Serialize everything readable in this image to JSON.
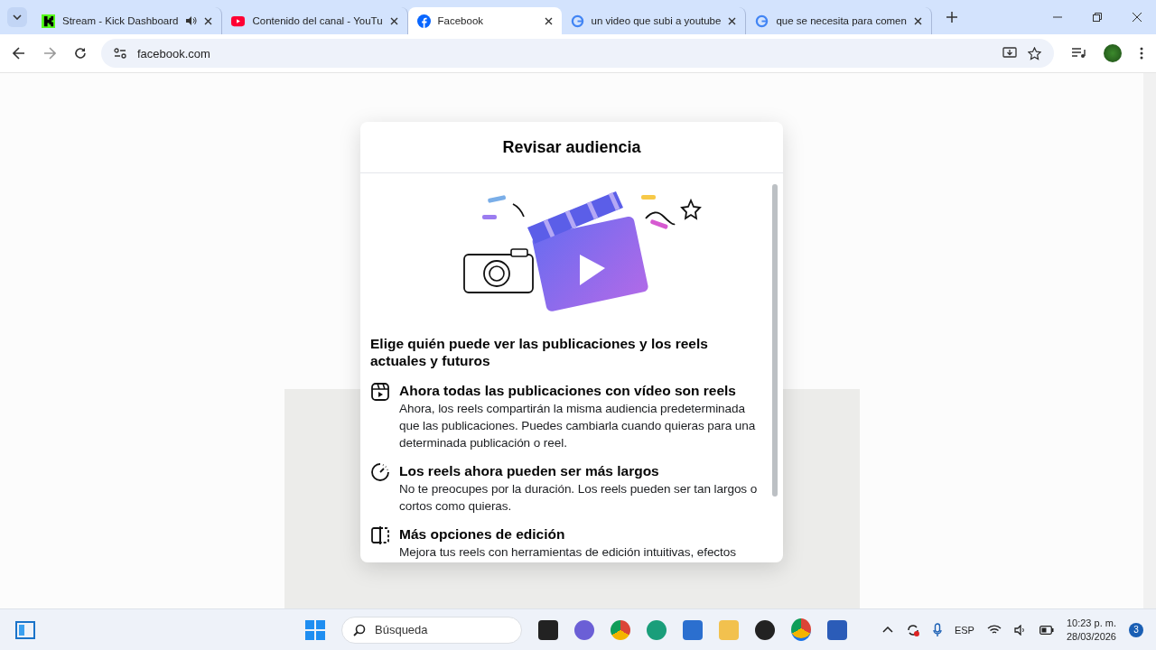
{
  "browser": {
    "tabs": [
      {
        "title": "Stream - Kick Dashboard",
        "audio": true,
        "selected": false
      },
      {
        "title": "Contenido del canal - YouTu",
        "audio": false,
        "selected": false
      },
      {
        "title": "Facebook",
        "audio": false,
        "selected": true
      },
      {
        "title": "un video que subi a youtube",
        "audio": false,
        "selected": false
      },
      {
        "title": "que se necesita para comen",
        "audio": false,
        "selected": false
      }
    ],
    "url": "facebook.com"
  },
  "dialog": {
    "title": "Revisar audiencia",
    "heading": "Elige quién puede ver las publicaciones y los reels actuales y futuros",
    "features": [
      {
        "title": "Ahora todas las publicaciones con vídeo son reels",
        "text": "Ahora, los reels compartirán la misma audiencia predeterminada que las publicaciones. Puedes cambiarla cuando quieras para una determinada publicación o reel."
      },
      {
        "title": "Los reels ahora pueden ser más largos",
        "text": "No te preocupes por la duración. Los reels pueden ser tan largos o cortos como quieras."
      },
      {
        "title": "Más opciones de edición",
        "text": "Mejora tus reels con herramientas de edición intuitivas, efectos"
      }
    ]
  },
  "taskbar": {
    "search_placeholder": "Búsqueda",
    "language": "ESP",
    "time": "10:23 p. m.",
    "date": "28/03/2026",
    "notifications": "3"
  }
}
